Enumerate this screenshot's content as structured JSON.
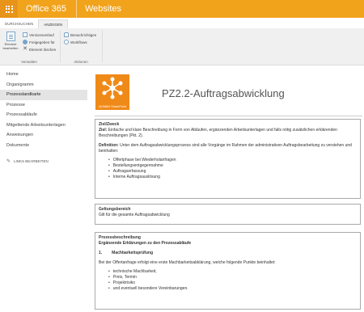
{
  "suite": {
    "brand": "Office 365",
    "site": "Websites"
  },
  "ribbon": {
    "tabs": [
      "DURCHSUCHEN",
      "ANZEIGEN"
    ],
    "groups": {
      "verwalten": {
        "label": "Verwalten",
        "edit_item": "Element bearbeiten",
        "version_history": "Versionsverlauf",
        "shared_with": "Freigegeben für",
        "delete_item": "Element löschen"
      },
      "aktionen": {
        "label": "Aktionen",
        "alert_me": "Benachrichtigen",
        "workflows": "Workflows"
      }
    }
  },
  "nav": {
    "items": [
      "Home",
      "Organigramm",
      "Prozesslandkarte",
      "Prozesse",
      "Prozessabläufe",
      "Mitgeltende Arbeitsunterlagen",
      "Anweisungen",
      "Dokumente"
    ],
    "selected_index": 2,
    "edit_links": "LINKS BEARBEITEN"
  },
  "logo": {
    "label": "QUMAN SharePoint"
  },
  "page": {
    "title": "PZ2.2-Auftragsabwicklung"
  },
  "sections": {
    "ziel": {
      "heading": "Ziel/Zweck",
      "ziel_label": "Ziel:",
      "ziel_text": "Einfache und klare Beschreibung in Form von Abläufen, ergänzenden Arbeitsunterlagen und falls nötig zusätzlichen erklärenden Beschreibungen (Pkt. 2).",
      "definition_label": "Definition:",
      "definition_text": "Unter dem Auftragsabwicklungsprozess sind alle Vorgänge im Rahmen der administrativen Auftragsbearbeitung zu verstehen und beinhalten:",
      "bullets": [
        "Offertphase bei Wiederholanfragen",
        "Bestellungsentgegennahme",
        "Auftragserfassung",
        "Interne Auftragsauslösung"
      ]
    },
    "geltung": {
      "heading": "Geltungsbereich",
      "text": "Gilt für die gesamte Auftragsabwicklung"
    },
    "prozess": {
      "heading": "Prozessbeschreibung",
      "subheading": "Ergänzende Erklärungen zu den Prozessabläufe",
      "num": "1.",
      "step_title": "Machbarkeitsprüfung",
      "intro": "Bei der Offertanfrage erfolgt eine erste Machbarkeitsabklärung, welche folgende Punkte beinhaltet:",
      "bullets": [
        "technische Machbarkeit,",
        "Preis, Termin",
        "Projektrisiko",
        "und eventuell besondere Vereinbarungen."
      ]
    }
  },
  "colors": {
    "suite_bar": "#f2a31c",
    "logo_bg": "#ef8a19"
  }
}
